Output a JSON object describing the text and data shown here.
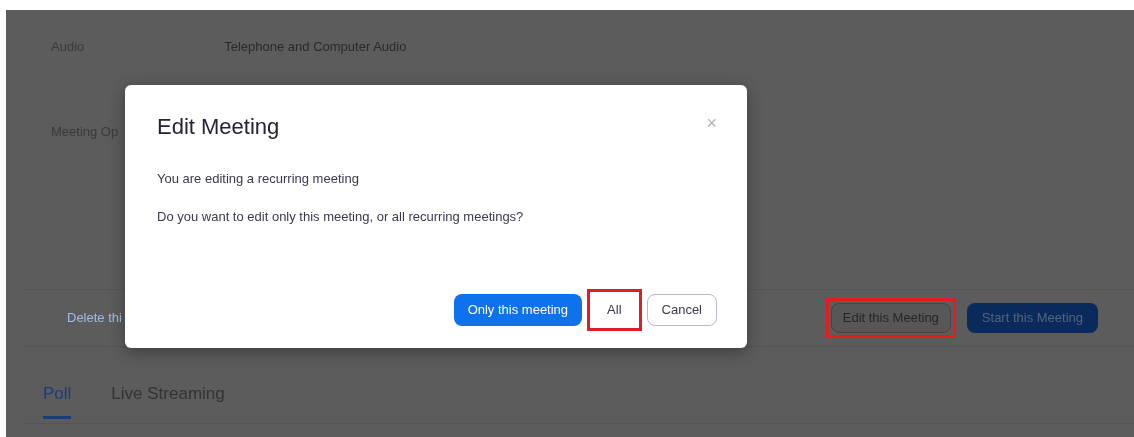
{
  "page": {
    "rows": [
      {
        "label": "Audio",
        "value": "Telephone and Computer Audio"
      },
      {
        "label": "Meeting Op",
        "value": ""
      }
    ],
    "delete_link": "Delete thi",
    "actions": [
      {
        "kind": "secondary",
        "label": "Edit this Meeting",
        "highlighted": true
      },
      {
        "kind": "primary",
        "label": "Start this Meeting",
        "highlighted": false
      }
    ],
    "tabs": [
      {
        "label": "Poll",
        "selected": true
      },
      {
        "label": "Live Streaming",
        "selected": false
      }
    ]
  },
  "dialog": {
    "title": "Edit Meeting",
    "close": "×",
    "messages": [
      "You are editing a recurring meeting",
      "Do you want to edit only this meeting, or all recurring meetings?"
    ],
    "buttons": [
      {
        "kind": "primary",
        "label": "Only this meeting",
        "highlighted": false
      },
      {
        "kind": "secondary",
        "label": "All",
        "highlighted": true
      },
      {
        "kind": "secondary",
        "label": "Cancel",
        "highlighted": false
      }
    ]
  }
}
